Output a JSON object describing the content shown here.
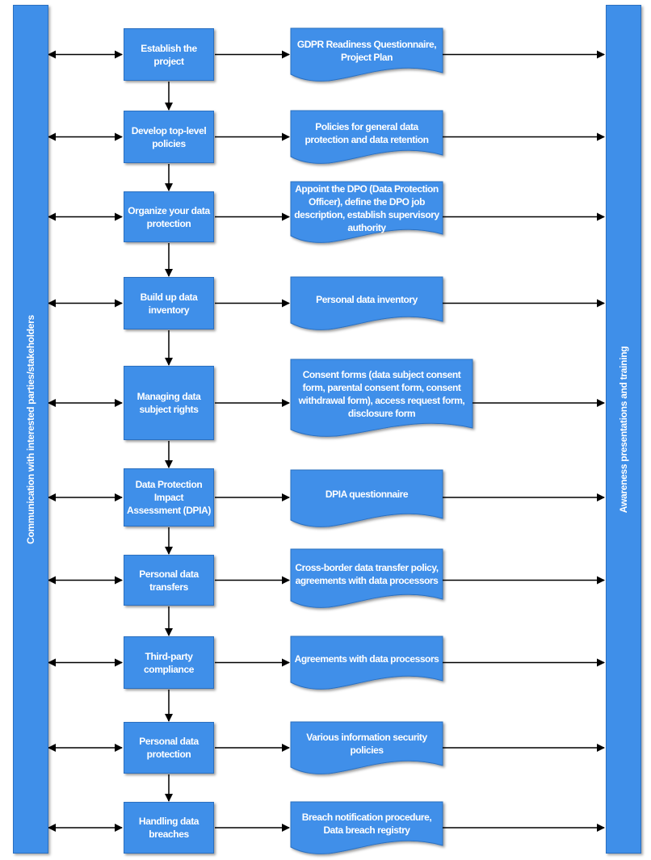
{
  "colors": {
    "fill": "#3f8fe9",
    "stroke": "#2a6fc0",
    "arrow": "#000000",
    "text": "#ffffff"
  },
  "left_bar": {
    "label": "Communication with interested parties/stakeholders"
  },
  "right_bar": {
    "label": "Awareness presentations and training"
  },
  "steps": [
    {
      "step": "Establish the project",
      "output": "GDPR Readiness Questionnaire, Project Plan"
    },
    {
      "step": "Develop top-level policies",
      "output": "Policies for general data protection and data retention"
    },
    {
      "step": "Organize your data protection",
      "output": "Appoint the DPO (Data Protection Officer), define the DPO job description, establish supervisory authority"
    },
    {
      "step": "Build up data inventory",
      "output": "Personal data inventory"
    },
    {
      "step": "Managing data subject rights",
      "output": "Consent forms (data subject consent form, parental consent form, consent withdrawal form), access request form, disclosure form"
    },
    {
      "step": "Data Protection Impact Assessment (DPIA)",
      "output": "DPIA questionnaire"
    },
    {
      "step": "Personal data transfers",
      "output": "Cross-border data transfer policy, agreements with data processors"
    },
    {
      "step": "Third-party compliance",
      "output": "Agreements with data processors"
    },
    {
      "step": "Personal data protection",
      "output": "Various information security policies"
    },
    {
      "step": "Handling data breaches",
      "output": "Breach notification procedure, Data breach registry"
    }
  ]
}
